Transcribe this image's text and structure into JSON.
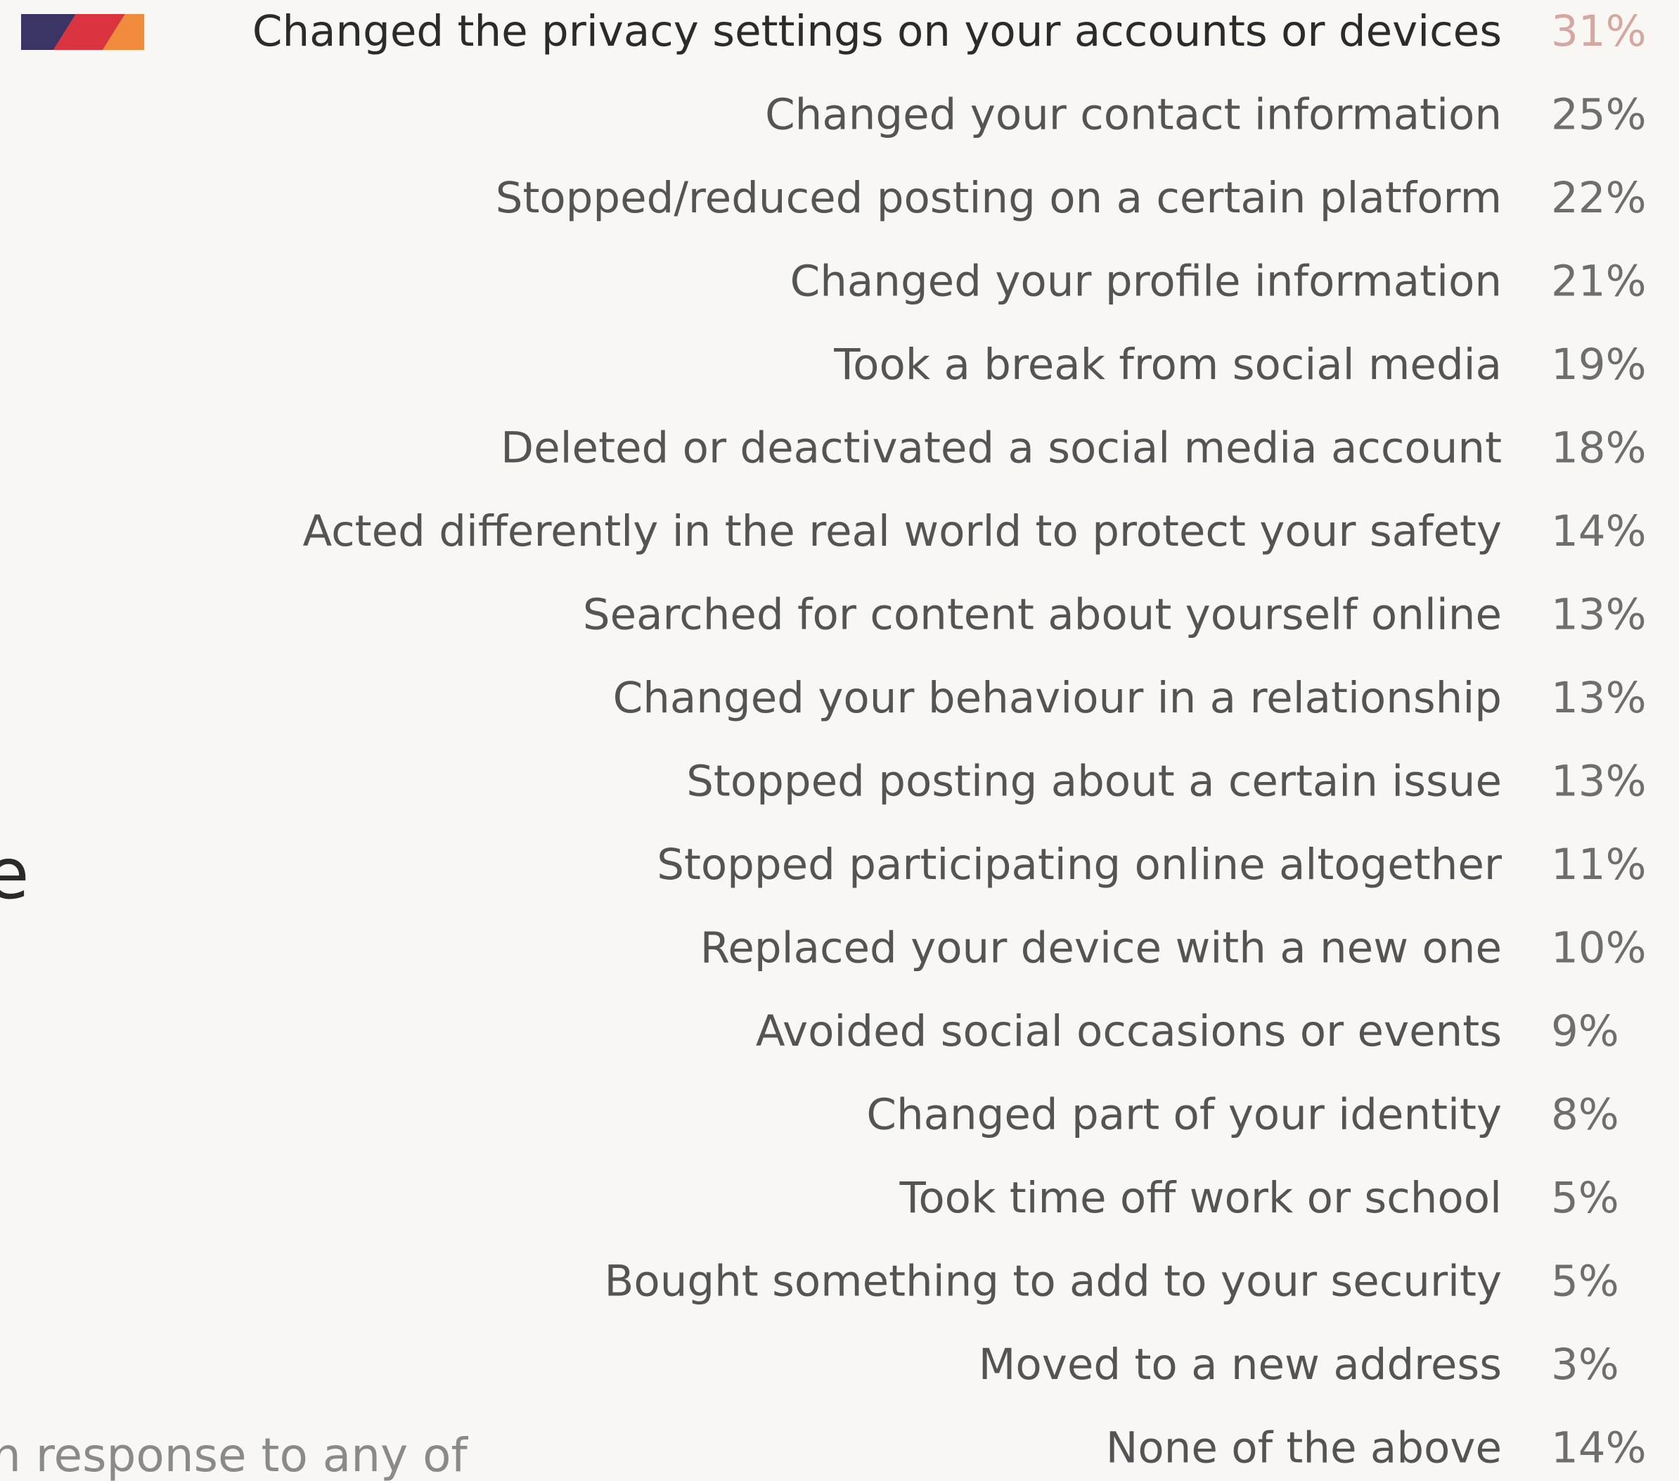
{
  "chart_data": {
    "type": "table",
    "categories": [
      "Changed the privacy settings on your accounts or devices",
      "Changed your contact information",
      "Stopped/reduced posting on a certain platform",
      "Changed your profile information",
      "Took a break from social media",
      "Deleted or deactivated a social media account",
      "Acted differently in the real world to protect your safety",
      "Searched for content about yourself online",
      "Changed your behaviour in a relationship",
      "Stopped posting about a certain issue",
      "Stopped participating online altogether",
      "Replaced your device with a new one",
      "Avoided social occasions or events",
      "Changed part of your identity",
      "Took time off work or school",
      "Bought something to add to your security",
      "Moved to a new address",
      "None of the above"
    ],
    "values": [
      31,
      25,
      22,
      21,
      19,
      18,
      14,
      13,
      13,
      13,
      11,
      10,
      9,
      8,
      5,
      5,
      3,
      14
    ],
    "value_labels": [
      "31%",
      "25%",
      "22%",
      "21%",
      "19%",
      "18%",
      "14%",
      "13%",
      "13%",
      "13%",
      "11%",
      "10%",
      "9%",
      "8%",
      "5%",
      "5%",
      "3%",
      "14%"
    ],
    "highlight_index": 0,
    "highlight_colors": [
      "#3b3566",
      "#d9343f",
      "#f08a3c"
    ],
    "label_color": "#545454",
    "highlight_label_color": "#2b2b2b",
    "value_color": "#6e6e6e",
    "highlight_value_color": "#d4a7a1"
  },
  "side": {
    "partial_letter": "e",
    "partial_caption": "n response to any of"
  }
}
